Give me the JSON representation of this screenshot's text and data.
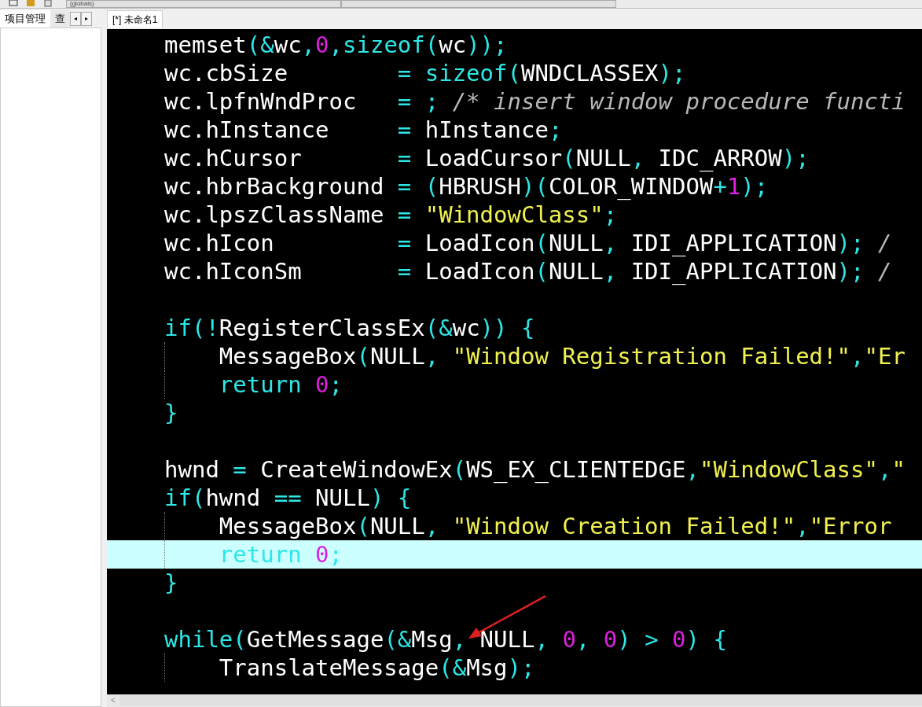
{
  "toolbar": {
    "scope_dropdown": "(globals)"
  },
  "left_panel": {
    "tabs": [
      {
        "label": "项目管理",
        "selected": true
      },
      {
        "label": "查",
        "selected": false
      }
    ],
    "scroll_buttons": [
      "◂",
      "▸"
    ]
  },
  "editor": {
    "tabs": [
      {
        "label": "[*] 未命名1",
        "selected": true
      }
    ],
    "lines": [
      {
        "highlighted": false,
        "guide": false,
        "tokens": [
          {
            "kind": "p",
            "text": "memset"
          },
          {
            "kind": "c",
            "text": "(&"
          },
          {
            "kind": "p",
            "text": "wc"
          },
          {
            "kind": "c",
            "text": ","
          },
          {
            "kind": "n",
            "text": "0"
          },
          {
            "kind": "c",
            "text": ","
          },
          {
            "kind": "c",
            "text": "sizeof("
          },
          {
            "kind": "p",
            "text": "wc"
          },
          {
            "kind": "c",
            "text": "));"
          }
        ]
      },
      {
        "highlighted": false,
        "guide": false,
        "tokens": [
          {
            "kind": "p",
            "text": "wc.cbSize        "
          },
          {
            "kind": "c",
            "text": "= sizeof("
          },
          {
            "kind": "p",
            "text": "WNDCLASSEX"
          },
          {
            "kind": "c",
            "text": ");"
          }
        ]
      },
      {
        "highlighted": false,
        "guide": false,
        "tokens": [
          {
            "kind": "p",
            "text": "wc.lpfnWndProc   "
          },
          {
            "kind": "c",
            "text": "= ; "
          },
          {
            "kind": "m",
            "text": "/* insert window procedure functi"
          }
        ]
      },
      {
        "highlighted": false,
        "guide": false,
        "tokens": [
          {
            "kind": "p",
            "text": "wc.hInstance     "
          },
          {
            "kind": "c",
            "text": "= "
          },
          {
            "kind": "p",
            "text": "hInstance"
          },
          {
            "kind": "c",
            "text": ";"
          }
        ]
      },
      {
        "highlighted": false,
        "guide": false,
        "tokens": [
          {
            "kind": "p",
            "text": "wc.hCursor       "
          },
          {
            "kind": "c",
            "text": "= "
          },
          {
            "kind": "p",
            "text": "LoadCursor"
          },
          {
            "kind": "c",
            "text": "("
          },
          {
            "kind": "p",
            "text": "NULL"
          },
          {
            "kind": "c",
            "text": ", "
          },
          {
            "kind": "p",
            "text": "IDC_ARROW"
          },
          {
            "kind": "c",
            "text": ");"
          }
        ]
      },
      {
        "highlighted": false,
        "guide": false,
        "tokens": [
          {
            "kind": "p",
            "text": "wc.hbrBackground "
          },
          {
            "kind": "c",
            "text": "= ("
          },
          {
            "kind": "p",
            "text": "HBRUSH"
          },
          {
            "kind": "c",
            "text": ")("
          },
          {
            "kind": "p",
            "text": "COLOR_WINDOW"
          },
          {
            "kind": "c",
            "text": "+"
          },
          {
            "kind": "n",
            "text": "1"
          },
          {
            "kind": "c",
            "text": ");"
          }
        ]
      },
      {
        "highlighted": false,
        "guide": false,
        "tokens": [
          {
            "kind": "p",
            "text": "wc.lpszClassName "
          },
          {
            "kind": "c",
            "text": "= "
          },
          {
            "kind": "s",
            "text": "\"WindowClass\""
          },
          {
            "kind": "c",
            "text": ";"
          }
        ]
      },
      {
        "highlighted": false,
        "guide": false,
        "tokens": [
          {
            "kind": "p",
            "text": "wc.hIcon         "
          },
          {
            "kind": "c",
            "text": "= "
          },
          {
            "kind": "p",
            "text": "LoadIcon"
          },
          {
            "kind": "c",
            "text": "("
          },
          {
            "kind": "p",
            "text": "NULL"
          },
          {
            "kind": "c",
            "text": ", "
          },
          {
            "kind": "p",
            "text": "IDI_APPLICATION"
          },
          {
            "kind": "c",
            "text": "); "
          },
          {
            "kind": "m",
            "text": "/"
          }
        ]
      },
      {
        "highlighted": false,
        "guide": false,
        "tokens": [
          {
            "kind": "p",
            "text": "wc.hIconSm       "
          },
          {
            "kind": "c",
            "text": "= "
          },
          {
            "kind": "p",
            "text": "LoadIcon"
          },
          {
            "kind": "c",
            "text": "("
          },
          {
            "kind": "p",
            "text": "NULL"
          },
          {
            "kind": "c",
            "text": ", "
          },
          {
            "kind": "p",
            "text": "IDI_APPLICATION"
          },
          {
            "kind": "c",
            "text": "); "
          },
          {
            "kind": "m",
            "text": "/"
          }
        ]
      },
      {
        "highlighted": false,
        "guide": false
      },
      {
        "highlighted": false,
        "guide": false,
        "tokens": [
          {
            "kind": "c",
            "text": "if(!"
          },
          {
            "kind": "p",
            "text": "RegisterClassEx"
          },
          {
            "kind": "c",
            "text": "(&"
          },
          {
            "kind": "p",
            "text": "wc"
          },
          {
            "kind": "c",
            "text": ")) {"
          }
        ]
      },
      {
        "highlighted": false,
        "guide": true,
        "tokens": [
          {
            "kind": "p",
            "text": "    MessageBox"
          },
          {
            "kind": "c",
            "text": "("
          },
          {
            "kind": "p",
            "text": "NULL"
          },
          {
            "kind": "c",
            "text": ", "
          },
          {
            "kind": "s",
            "text": "\"Window Registration Failed!\""
          },
          {
            "kind": "c",
            "text": ","
          },
          {
            "kind": "s",
            "text": "\"Er"
          }
        ]
      },
      {
        "highlighted": false,
        "guide": true,
        "tokens": [
          {
            "kind": "c",
            "text": "    return "
          },
          {
            "kind": "n",
            "text": "0"
          },
          {
            "kind": "c",
            "text": ";"
          }
        ]
      },
      {
        "highlighted": false,
        "guide": false,
        "tokens": [
          {
            "kind": "c",
            "text": "}"
          }
        ]
      },
      {
        "highlighted": false,
        "guide": false
      },
      {
        "highlighted": false,
        "guide": false,
        "tokens": [
          {
            "kind": "p",
            "text": "hwnd "
          },
          {
            "kind": "c",
            "text": "= "
          },
          {
            "kind": "p",
            "text": "CreateWindowEx"
          },
          {
            "kind": "c",
            "text": "("
          },
          {
            "kind": "p",
            "text": "WS_EX_CLIENTEDGE"
          },
          {
            "kind": "c",
            "text": ","
          },
          {
            "kind": "s",
            "text": "\"WindowClass\""
          },
          {
            "kind": "c",
            "text": ","
          },
          {
            "kind": "s",
            "text": "\""
          }
        ]
      },
      {
        "highlighted": false,
        "guide": false,
        "tokens": [
          {
            "kind": "c",
            "text": "if("
          },
          {
            "kind": "p",
            "text": "hwnd "
          },
          {
            "kind": "c",
            "text": "== "
          },
          {
            "kind": "p",
            "text": "NULL"
          },
          {
            "kind": "c",
            "text": ") {"
          }
        ]
      },
      {
        "highlighted": false,
        "guide": true,
        "tokens": [
          {
            "kind": "p",
            "text": "    MessageBox"
          },
          {
            "kind": "c",
            "text": "("
          },
          {
            "kind": "p",
            "text": "NULL"
          },
          {
            "kind": "c",
            "text": ", "
          },
          {
            "kind": "s",
            "text": "\"Window Creation Failed!\""
          },
          {
            "kind": "c",
            "text": ","
          },
          {
            "kind": "s",
            "text": "\"Error"
          }
        ]
      },
      {
        "highlighted": true,
        "guide": true,
        "tokens": [
          {
            "kind": "c",
            "text": "    return "
          },
          {
            "kind": "n",
            "text": "0"
          },
          {
            "kind": "c",
            "text": ";"
          }
        ]
      },
      {
        "highlighted": false,
        "guide": false,
        "tokens": [
          {
            "kind": "c",
            "text": "}"
          }
        ]
      },
      {
        "highlighted": false,
        "guide": false
      },
      {
        "highlighted": false,
        "guide": false,
        "tokens": [
          {
            "kind": "c",
            "text": "while("
          },
          {
            "kind": "p",
            "text": "GetMessage"
          },
          {
            "kind": "c",
            "text": "(&"
          },
          {
            "kind": "p",
            "text": "Msg"
          },
          {
            "kind": "c",
            "text": ", "
          },
          {
            "kind": "p",
            "text": "NULL"
          },
          {
            "kind": "c",
            "text": ", "
          },
          {
            "kind": "n",
            "text": "0"
          },
          {
            "kind": "c",
            "text": ", "
          },
          {
            "kind": "n",
            "text": "0"
          },
          {
            "kind": "c",
            "text": ") > "
          },
          {
            "kind": "n",
            "text": "0"
          },
          {
            "kind": "c",
            "text": ") {"
          }
        ]
      },
      {
        "highlighted": false,
        "guide": true,
        "tokens": [
          {
            "kind": "p",
            "text": "    TranslateMessage"
          },
          {
            "kind": "c",
            "text": "(&"
          },
          {
            "kind": "p",
            "text": "Msg"
          },
          {
            "kind": "c",
            "text": ");"
          }
        ]
      }
    ],
    "scroll_left": "<"
  }
}
